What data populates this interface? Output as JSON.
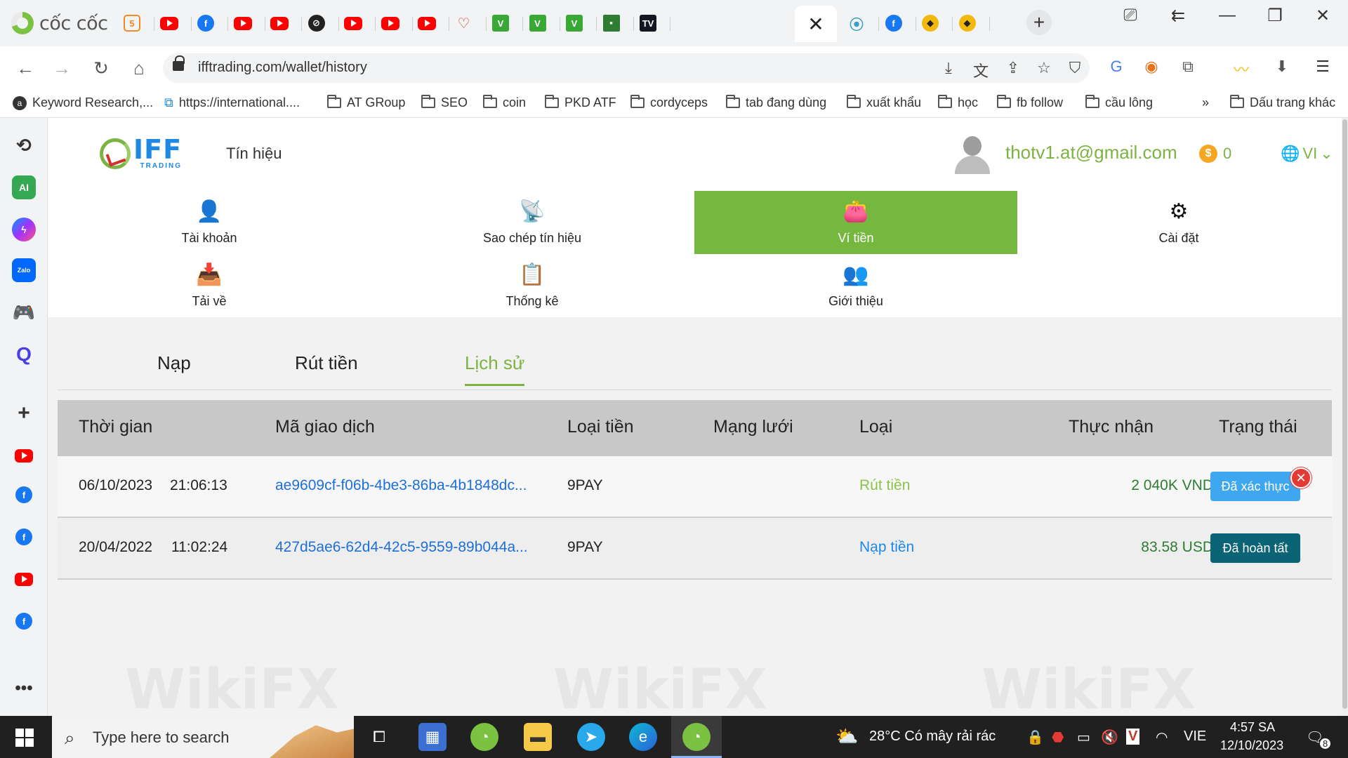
{
  "browser": {
    "name": "cốc cốc",
    "tabs": [
      {
        "icon": "orange-doc-icon"
      },
      {
        "icon": "youtube-icon"
      },
      {
        "icon": "facebook-icon"
      },
      {
        "icon": "youtube-icon"
      },
      {
        "icon": "youtube-icon"
      },
      {
        "icon": "exness-icon"
      },
      {
        "icon": "youtube-icon"
      },
      {
        "icon": "youtube-icon"
      },
      {
        "icon": "youtube-icon"
      },
      {
        "icon": "heart-icon"
      },
      {
        "icon": "v-icon"
      },
      {
        "icon": "v-icon"
      },
      {
        "icon": "v-icon"
      },
      {
        "icon": "investing-icon"
      },
      {
        "icon": "tradingview-icon"
      }
    ],
    "tabs_after_active": [
      {
        "icon": "map-pin-icon"
      },
      {
        "icon": "facebook-icon"
      },
      {
        "icon": "binance-icon"
      },
      {
        "icon": "binance-icon"
      }
    ],
    "url": "ifftrading.com/wallet/history",
    "bookmarks": [
      "Keyword Research,...",
      "https://international....",
      "AT GRoup",
      "SEO",
      "coin",
      "PKD ATF",
      "cordyceps",
      "tab đang dùng",
      "xuất khẩu",
      "học",
      "fb follow",
      "cầu lông"
    ],
    "bookmarks_more": "»",
    "bookmarks_other": "Dấu trang khác",
    "sidebar_ai_label": "AI",
    "sidebar_zalo_label": "Zalo"
  },
  "site": {
    "brand": "IFF",
    "brand_sub": "TRADING",
    "nav_signal": "Tín hiệu",
    "user_email": "thotv1.at@gmail.com",
    "coin_symbol": "$",
    "coin_count": "0",
    "lang": "VI",
    "menu": [
      {
        "label": "Tài khoản",
        "icon": "user-icon",
        "glyph": "👤"
      },
      {
        "label": "Sao chép tín hiệu",
        "icon": "copy-signal-icon",
        "glyph": "📡"
      },
      {
        "label": "Ví tiền",
        "icon": "wallet-icon",
        "glyph": "👛",
        "active": true
      },
      {
        "label": "Cài đặt",
        "icon": "gear-icon",
        "glyph": "⚙"
      },
      {
        "label": "Tải về",
        "icon": "download-icon",
        "glyph": "📥"
      },
      {
        "label": "Thống kê",
        "icon": "statistics-icon",
        "glyph": "📋"
      },
      {
        "label": "Giới thiệu",
        "icon": "referral-icon",
        "glyph": "👥"
      }
    ],
    "wallet_tabs": [
      {
        "label": "Nạp"
      },
      {
        "label": "Rút tiền"
      },
      {
        "label": "Lịch sử",
        "active": true
      }
    ],
    "table": {
      "headers": [
        "Thời gian",
        "Mã giao dịch",
        "Loại tiền",
        "Mạng lưới",
        "Loại",
        "Thực nhận",
        "Trạng thái"
      ],
      "rows": [
        {
          "date": "06/10/2023",
          "time": "21:06:13",
          "tx_id": "ae9609cf-f06b-4be3-86ba-4b1848dc...",
          "currency": "9PAY",
          "network": "",
          "type": "Rút tiền",
          "received": "2 040K VND",
          "status": "Đã xác thực"
        },
        {
          "date": "20/04/2022",
          "time": "11:02:24",
          "tx_id": "427d5ae6-62d4-42c5-9559-89b044a...",
          "currency": "9PAY",
          "network": "",
          "type": "Nạp tiền",
          "received": "83.58 USD",
          "status": "Đã hoàn tất"
        }
      ]
    },
    "watermark": "WikiFX"
  },
  "taskbar": {
    "search_placeholder": "Type here to search",
    "weather": "28°C  Có mây rải rác",
    "lang": "VIE",
    "time": "4:57 SA",
    "date": "12/10/2023",
    "notifications": "8"
  },
  "colors": {
    "brand_green": "#76b83f",
    "link_blue": "#1e6fd9",
    "badge_confirm": "#3fa7f0",
    "badge_done": "#0b6376",
    "close_red": "#e53935"
  }
}
